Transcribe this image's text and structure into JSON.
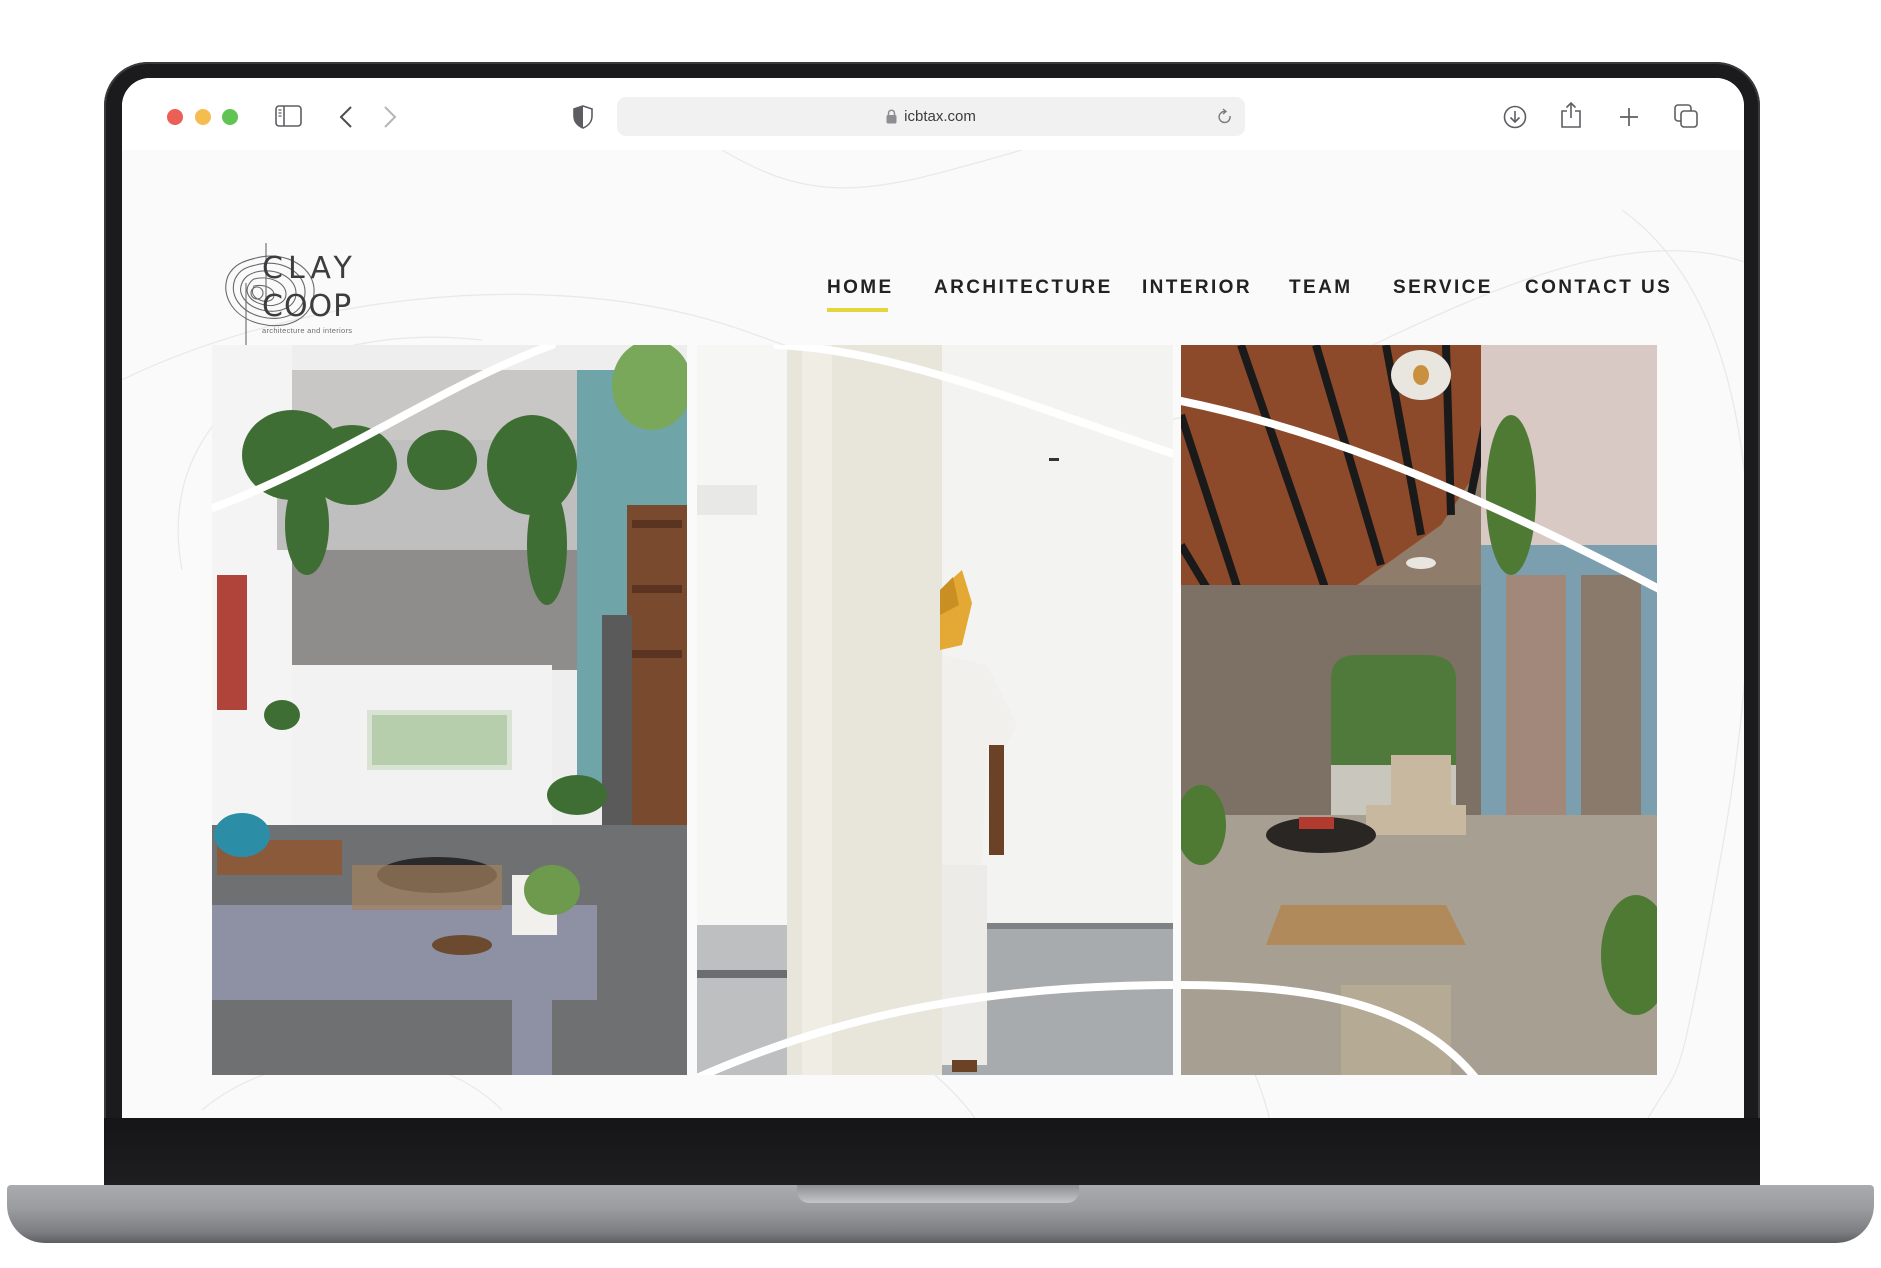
{
  "browser": {
    "url": "icbtax.com",
    "traffic_lights": {
      "close": "#ec5f57",
      "minimize": "#f5bd4f",
      "maximize": "#5fc454"
    },
    "icons": [
      "sidebar-icon",
      "back-icon",
      "forward-icon",
      "shield-icon",
      "lock-icon",
      "reload-icon",
      "download-icon",
      "share-icon",
      "new-tab-icon",
      "tabs-overview-icon"
    ]
  },
  "site": {
    "logo": {
      "line1": "CLAY",
      "line2": "COOP",
      "tagline": "architecture and interiors"
    },
    "nav": [
      {
        "label": "HOME",
        "active": true
      },
      {
        "label": "ARCHITECTURE",
        "active": false
      },
      {
        "label": "INTERIOR",
        "active": false
      },
      {
        "label": "TEAM",
        "active": false
      },
      {
        "label": "SERVICE",
        "active": false
      },
      {
        "label": "CONTACT US",
        "active": false
      }
    ],
    "accent_color": "#e5d63c",
    "gallery": [
      {
        "subject": "double-height living room with hanging plants, teal wall and wooden shelves"
      },
      {
        "subject": "person in white with a yellow paper animal mask behind a white column"
      },
      {
        "subject": "verandah with timber-slatted ceiling, stone wall arch, lounge chair and jute rug"
      }
    ]
  }
}
